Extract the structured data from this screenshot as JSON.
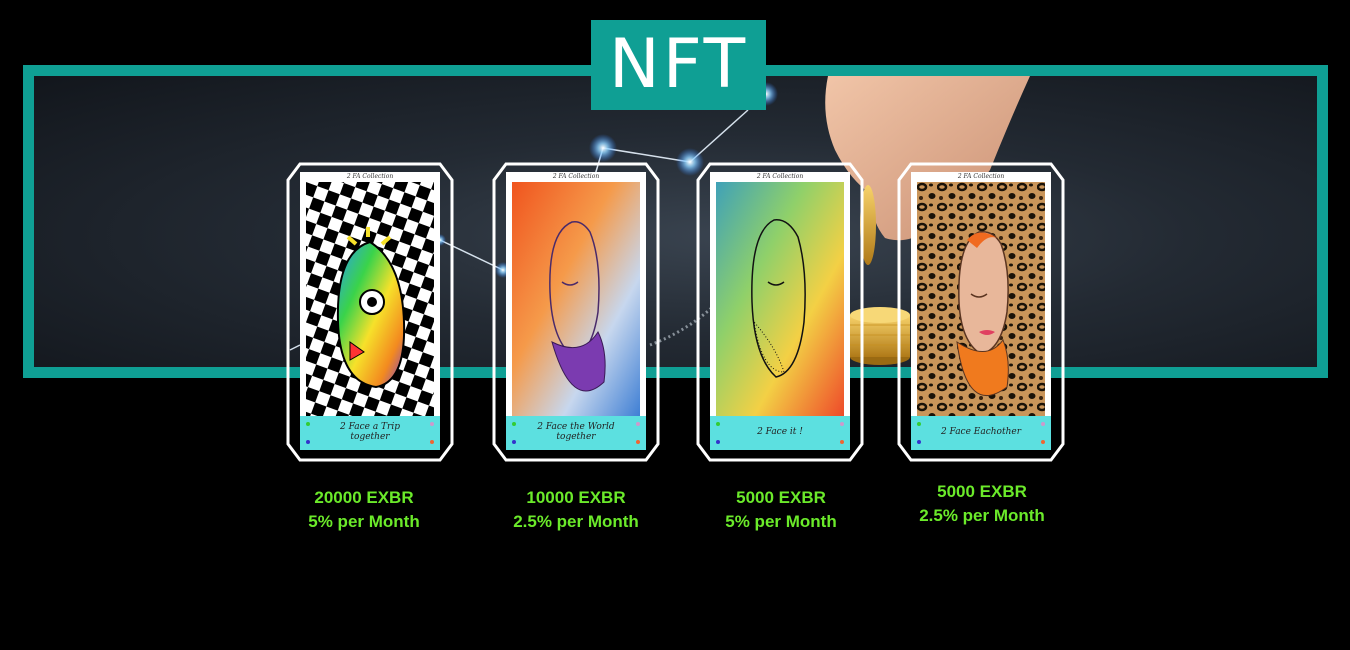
{
  "banner": {
    "title": "NFT",
    "accent_color": "#0f9f94"
  },
  "cards": [
    {
      "collection": "2 FA Collection",
      "caption": "2 Face a Trip together",
      "price": "20000 EXBR",
      "rate": "5% per Month",
      "art_style": "black-white-checkerboard-rainbow-face"
    },
    {
      "collection": "2 FA Collection",
      "caption": "2 Face the World together",
      "price": "10000 EXBR",
      "rate": "2.5% per Month",
      "art_style": "orange-blue-polygon-purple-beard-face"
    },
    {
      "collection": "2 FA Collection",
      "caption": "2 Face it !",
      "price": "5000 EXBR",
      "rate": "5% per Month",
      "art_style": "rainbow-polygon-line-face"
    },
    {
      "collection": "2 FA Collection",
      "caption": "2 Face Eachother",
      "price": "5000 EXBR",
      "rate": "2.5% per Month",
      "art_style": "leopard-print-orange-beard-face"
    }
  ],
  "colors": {
    "price_text": "#6bea2a",
    "caption_strip": "#5ce0e0",
    "frame": "#ffffff"
  }
}
